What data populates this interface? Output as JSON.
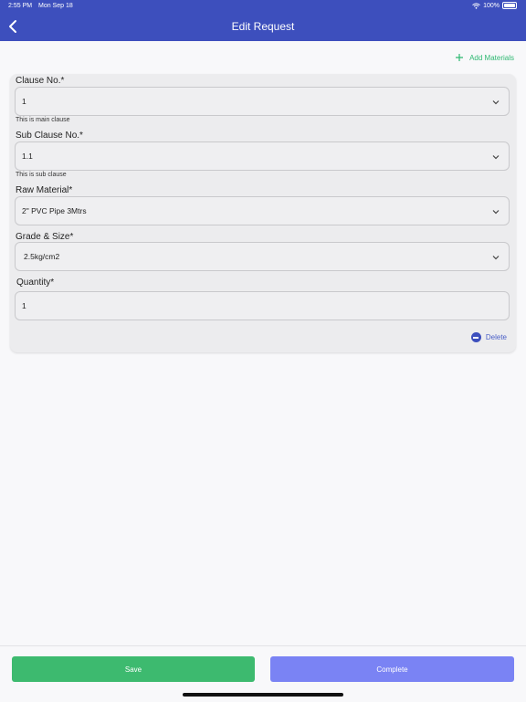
{
  "status_bar": {
    "time": "2:55 PM",
    "date": "Mon Sep 18",
    "battery": "100%"
  },
  "header": {
    "title": "Edit Request"
  },
  "actions": {
    "add_materials": "Add Materials",
    "delete": "Delete"
  },
  "form": {
    "clause": {
      "label": "Clause No.*",
      "value": "1",
      "hint": "This is main clause"
    },
    "sub_clause": {
      "label": "Sub Clause No.*",
      "value": "1.1",
      "hint": "This is sub clause"
    },
    "raw_material": {
      "label": "Raw Material*",
      "value": "2\" PVC Pipe 3Mtrs"
    },
    "grade": {
      "label": "Grade & Size*",
      "value": "2.5kg/cm2"
    },
    "quantity": {
      "label": "Quantity*",
      "value": "1"
    }
  },
  "footer": {
    "save": "Save",
    "complete": "Complete"
  },
  "colors": {
    "primary": "#3d4fbd",
    "success": "#3dba6f",
    "accent": "#7a83f4"
  }
}
